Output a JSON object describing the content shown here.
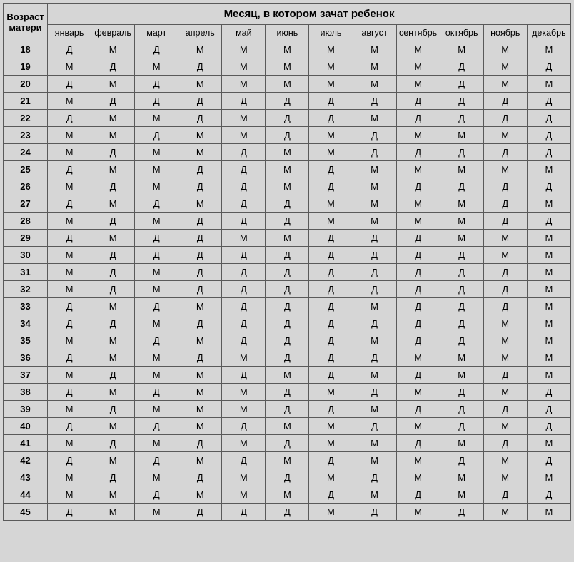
{
  "header": {
    "row_label": "Возраст матери",
    "col_label": "Месяц, в котором зачат ребенок"
  },
  "months": [
    "январь",
    "февраль",
    "март",
    "апрель",
    "май",
    "июнь",
    "июль",
    "август",
    "сентябрь",
    "октябрь",
    "ноябрь",
    "декабрь"
  ],
  "rows": [
    {
      "age": "18",
      "v": [
        "Д",
        "М",
        "Д",
        "М",
        "М",
        "М",
        "М",
        "М",
        "М",
        "М",
        "М",
        "М"
      ]
    },
    {
      "age": "19",
      "v": [
        "М",
        "Д",
        "М",
        "Д",
        "М",
        "М",
        "М",
        "М",
        "М",
        "Д",
        "М",
        "Д"
      ]
    },
    {
      "age": "20",
      "v": [
        "Д",
        "М",
        "Д",
        "М",
        "М",
        "М",
        "М",
        "М",
        "М",
        "Д",
        "М",
        "М"
      ]
    },
    {
      "age": "21",
      "v": [
        "М",
        "Д",
        "Д",
        "Д",
        "Д",
        "Д",
        "Д",
        "Д",
        "Д",
        "Д",
        "Д",
        "Д"
      ]
    },
    {
      "age": "22",
      "v": [
        "Д",
        "М",
        "М",
        "Д",
        "М",
        "Д",
        "Д",
        "М",
        "Д",
        "Д",
        "Д",
        "Д"
      ]
    },
    {
      "age": "23",
      "v": [
        "М",
        "М",
        "Д",
        "М",
        "М",
        "Д",
        "М",
        "Д",
        "М",
        "М",
        "М",
        "Д"
      ]
    },
    {
      "age": "24",
      "v": [
        "М",
        "Д",
        "М",
        "М",
        "Д",
        "М",
        "М",
        "Д",
        "Д",
        "Д",
        "Д",
        "Д"
      ]
    },
    {
      "age": "25",
      "v": [
        "Д",
        "М",
        "М",
        "Д",
        "Д",
        "М",
        "Д",
        "М",
        "М",
        "М",
        "М",
        "М"
      ]
    },
    {
      "age": "26",
      "v": [
        "М",
        "Д",
        "М",
        "Д",
        "Д",
        "М",
        "Д",
        "М",
        "Д",
        "Д",
        "Д",
        "Д"
      ]
    },
    {
      "age": "27",
      "v": [
        "Д",
        "М",
        "Д",
        "М",
        "Д",
        "Д",
        "М",
        "М",
        "М",
        "М",
        "Д",
        "М"
      ]
    },
    {
      "age": "28",
      "v": [
        "М",
        "Д",
        "М",
        "Д",
        "Д",
        "Д",
        "М",
        "М",
        "М",
        "М",
        "Д",
        "Д"
      ]
    },
    {
      "age": "29",
      "v": [
        "Д",
        "М",
        "Д",
        "Д",
        "М",
        "М",
        "Д",
        "Д",
        "Д",
        "М",
        "М",
        "М"
      ]
    },
    {
      "age": "30",
      "v": [
        "М",
        "Д",
        "Д",
        "Д",
        "Д",
        "Д",
        "Д",
        "Д",
        "Д",
        "Д",
        "М",
        "М"
      ]
    },
    {
      "age": "31",
      "v": [
        "М",
        "Д",
        "М",
        "Д",
        "Д",
        "Д",
        "Д",
        "Д",
        "Д",
        "Д",
        "Д",
        "М"
      ]
    },
    {
      "age": "32",
      "v": [
        "М",
        "Д",
        "М",
        "Д",
        "Д",
        "Д",
        "Д",
        "Д",
        "Д",
        "Д",
        "Д",
        "М"
      ]
    },
    {
      "age": "33",
      "v": [
        "Д",
        "М",
        "Д",
        "М",
        "Д",
        "Д",
        "Д",
        "М",
        "Д",
        "Д",
        "Д",
        "М"
      ]
    },
    {
      "age": "34",
      "v": [
        "Д",
        "Д",
        "М",
        "Д",
        "Д",
        "Д",
        "Д",
        "Д",
        "Д",
        "Д",
        "М",
        "М"
      ]
    },
    {
      "age": "35",
      "v": [
        "М",
        "М",
        "Д",
        "М",
        "Д",
        "Д",
        "Д",
        "М",
        "Д",
        "Д",
        "М",
        "М"
      ]
    },
    {
      "age": "36",
      "v": [
        "Д",
        "М",
        "М",
        "Д",
        "М",
        "Д",
        "Д",
        "Д",
        "М",
        "М",
        "М",
        "М"
      ]
    },
    {
      "age": "37",
      "v": [
        "М",
        "Д",
        "М",
        "М",
        "Д",
        "М",
        "Д",
        "М",
        "Д",
        "М",
        "Д",
        "М"
      ]
    },
    {
      "age": "38",
      "v": [
        "Д",
        "М",
        "Д",
        "М",
        "М",
        "Д",
        "М",
        "Д",
        "М",
        "Д",
        "М",
        "Д"
      ]
    },
    {
      "age": "39",
      "v": [
        "М",
        "Д",
        "М",
        "М",
        "М",
        "Д",
        "Д",
        "М",
        "Д",
        "Д",
        "Д",
        "Д"
      ]
    },
    {
      "age": "40",
      "v": [
        "Д",
        "М",
        "Д",
        "М",
        "Д",
        "М",
        "М",
        "Д",
        "М",
        "Д",
        "М",
        "Д"
      ]
    },
    {
      "age": "41",
      "v": [
        "М",
        "Д",
        "М",
        "Д",
        "М",
        "Д",
        "М",
        "М",
        "Д",
        "М",
        "Д",
        "М"
      ]
    },
    {
      "age": "42",
      "v": [
        "Д",
        "М",
        "Д",
        "М",
        "Д",
        "М",
        "Д",
        "М",
        "М",
        "Д",
        "М",
        "Д"
      ]
    },
    {
      "age": "43",
      "v": [
        "М",
        "Д",
        "М",
        "Д",
        "М",
        "Д",
        "М",
        "Д",
        "М",
        "М",
        "М",
        "М"
      ]
    },
    {
      "age": "44",
      "v": [
        "М",
        "М",
        "Д",
        "М",
        "М",
        "М",
        "Д",
        "М",
        "Д",
        "М",
        "Д",
        "Д"
      ]
    },
    {
      "age": "45",
      "v": [
        "Д",
        "М",
        "М",
        "Д",
        "Д",
        "Д",
        "М",
        "Д",
        "М",
        "Д",
        "М",
        "М"
      ]
    }
  ]
}
